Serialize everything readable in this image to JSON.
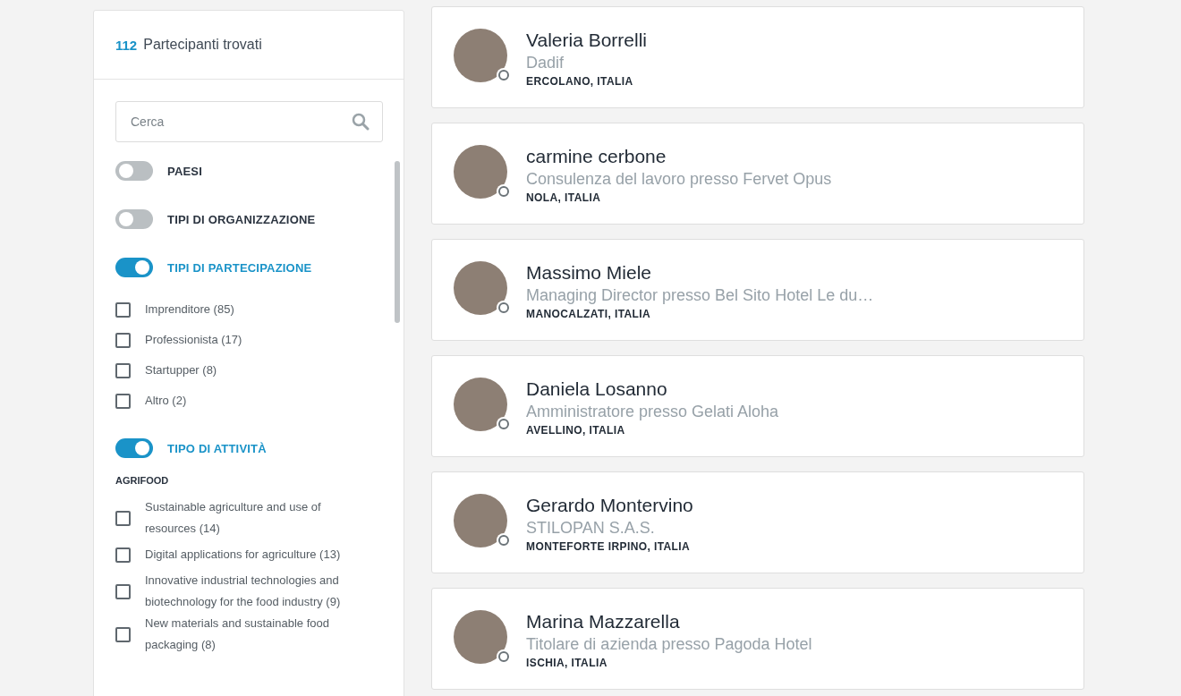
{
  "sidebar": {
    "count": "112",
    "title": "Partecipanti trovati",
    "search": {
      "placeholder": "Cerca"
    },
    "filters": [
      {
        "label": "PAESI",
        "on": false
      },
      {
        "label": "TIPI DI ORGANIZZAZIONE",
        "on": false
      },
      {
        "label": "TIPI DI PARTECIPAZIONE",
        "on": true,
        "groups": [
          {
            "options": [
              {
                "label": "Imprenditore (85)",
                "checked": false
              },
              {
                "label": "Professionista (17)",
                "checked": false
              },
              {
                "label": "Startupper (8)",
                "checked": false
              },
              {
                "label": "Altro (2)",
                "checked": false
              }
            ]
          }
        ]
      },
      {
        "label": "TIPO DI ATTIVITÀ",
        "on": true,
        "groups": [
          {
            "heading": "AGRIFOOD",
            "options": [
              {
                "label": "Sustainable agriculture and use of resources (14)",
                "checked": false
              },
              {
                "label": "Digital applications for agriculture (13)",
                "checked": false
              },
              {
                "label": "Innovative industrial technologies and biotechnology for the food industry (9)",
                "checked": false
              },
              {
                "label": "New materials and sustainable food packaging (8)",
                "checked": false
              }
            ]
          }
        ]
      }
    ]
  },
  "participants": [
    {
      "name": "Valeria Borrelli",
      "role": "Dadif",
      "location": "ERCOLANO, ITALIA"
    },
    {
      "name": "carmine cerbone",
      "role": "Consulenza del lavoro presso Fervet Opus",
      "location": "NOLA, ITALIA"
    },
    {
      "name": "Massimo Miele",
      "role": "Managing Director presso Bel Sito Hotel Le du…",
      "location": "MANOCALZATI, ITALIA"
    },
    {
      "name": "Daniela Losanno",
      "role": "Amministratore presso Gelati Aloha",
      "location": "AVELLINO, ITALIA"
    },
    {
      "name": "Gerardo Montervino",
      "role": "STILOPAN S.A.S.",
      "location": "MONTEFORTE IRPINO, ITALIA"
    },
    {
      "name": "Marina Mazzarella",
      "role": "Titolare di azienda presso Pagoda Hotel",
      "location": "ISCHIA, ITALIA"
    }
  ]
}
